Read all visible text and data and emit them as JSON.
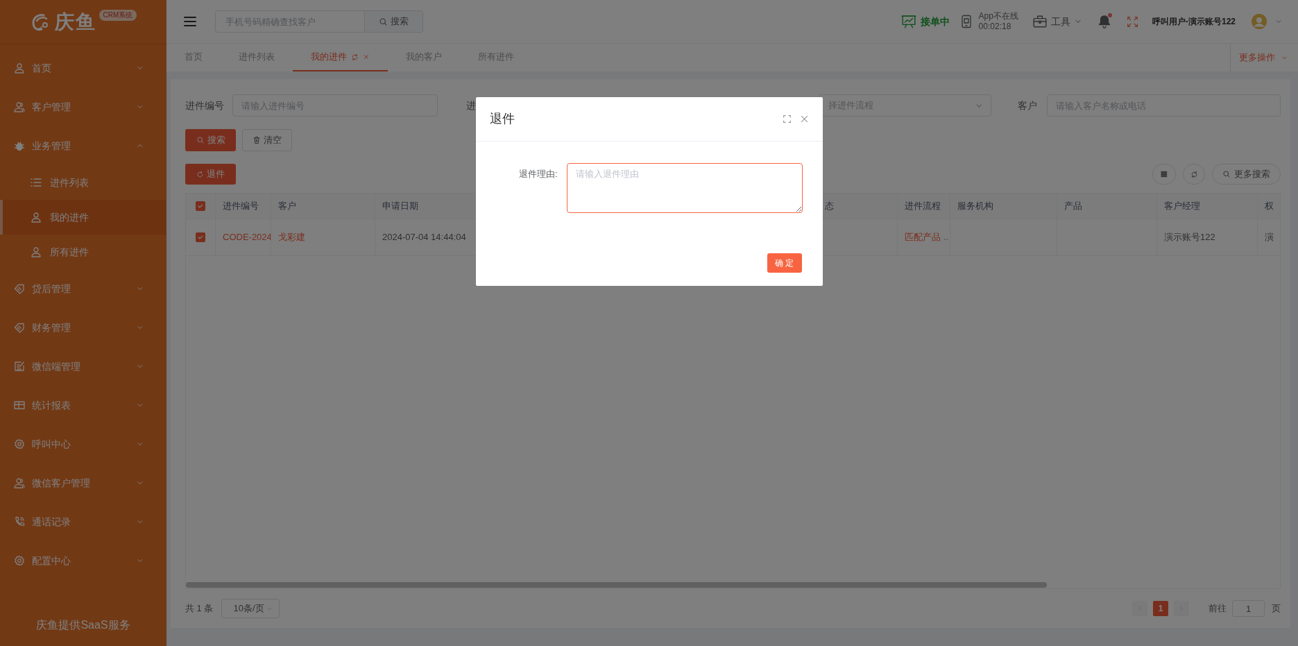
{
  "sidebar": {
    "logo_text": "庆鱼",
    "logo_badge": "CRM系统",
    "items": [
      {
        "label": "首页",
        "expanded": false
      },
      {
        "label": "客户管理",
        "expanded": false
      },
      {
        "label": "业务管理",
        "expanded": true,
        "children": [
          {
            "label": "进件列表",
            "selected": false
          },
          {
            "label": "我的进件",
            "selected": true
          },
          {
            "label": "所有进件",
            "selected": false
          }
        ]
      },
      {
        "label": "贷后管理",
        "expanded": false
      },
      {
        "label": "财务管理",
        "expanded": false
      },
      {
        "label": "微信端管理",
        "expanded": false
      },
      {
        "label": "统计报表",
        "expanded": false
      },
      {
        "label": "呼叫中心",
        "expanded": false
      },
      {
        "label": "微信客户管理",
        "expanded": false
      },
      {
        "label": "通话记录",
        "expanded": false
      },
      {
        "label": "配置中心",
        "expanded": false
      }
    ],
    "footer": "庆鱼提供SaaS服务"
  },
  "header": {
    "search_placeholder": "手机号码精确查找客户",
    "search_button": "搜索",
    "order_status": "接单中",
    "app_status": "App不在线",
    "app_time": "00:02:18",
    "tools": "工具",
    "unread": true,
    "user": "呼叫用户-演示账号122"
  },
  "tabs": [
    {
      "label": "首页",
      "selected": false
    },
    {
      "label": "进件列表",
      "selected": false
    },
    {
      "label": "我的进件",
      "selected": true
    },
    {
      "label": "我的客户",
      "selected": false
    },
    {
      "label": "所有进件",
      "selected": false
    }
  ],
  "more_actions": "更多操作",
  "filters": {
    "code_label": "进件编号",
    "code_placeholder": "请输入进件编号",
    "label_2": "进",
    "flow_placeholder": "择进件流程",
    "customer_label": "客户",
    "customer_placeholder": "请输入客户名称或电话"
  },
  "buttons": {
    "search": "搜索",
    "clear": "清空",
    "return": "退件",
    "more_search": "更多搜索"
  },
  "table": {
    "header_checked": true,
    "columns": [
      "进件编号",
      "客户",
      "申请日期",
      "态",
      "进件流程",
      "服务机构",
      "产品",
      "客户经理",
      "权"
    ],
    "rows": [
      {
        "checked": true,
        "code": "CODE-2024",
        "customer": "戈彩建",
        "date": "2024-07-04 14:44:04",
        "flow": "匹配产品",
        "flow_more": "..",
        "manager": "演示账号122",
        "column_9": "演"
      }
    ]
  },
  "pagination": {
    "total": "共 1 条",
    "page_size": "10条/页",
    "pages": [
      {
        "label": "1",
        "selected": true
      }
    ],
    "goto_label": "前往",
    "goto_value": "1",
    "goto_suffix": "页"
  },
  "dialog": {
    "title": "退件",
    "field_label": "退件理由:",
    "placeholder": "请输入退件理由",
    "confirm": "确 定"
  }
}
